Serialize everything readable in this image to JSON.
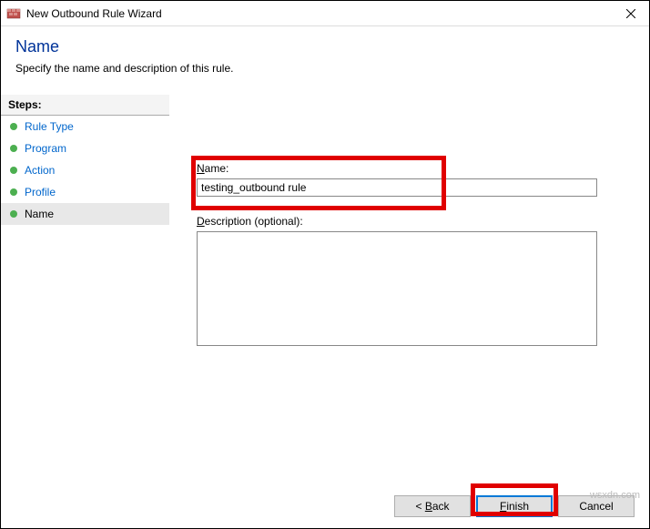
{
  "titlebar": {
    "text": "New Outbound Rule Wizard"
  },
  "header": {
    "title": "Name",
    "subtitle": "Specify the name and description of this rule."
  },
  "steps": {
    "label": "Steps:",
    "items": [
      {
        "label": "Rule Type",
        "state": "done"
      },
      {
        "label": "Program",
        "state": "done"
      },
      {
        "label": "Action",
        "state": "done"
      },
      {
        "label": "Profile",
        "state": "done"
      },
      {
        "label": "Name",
        "state": "current"
      }
    ]
  },
  "form": {
    "name_label_underline": "N",
    "name_label_rest": "ame:",
    "name_value": "testing_outbound rule",
    "desc_label_underline": "D",
    "desc_label_rest": "escription (optional):",
    "desc_value": ""
  },
  "buttons": {
    "back_prefix": "< ",
    "back_underline": "B",
    "back_rest": "ack",
    "finish_underline": "F",
    "finish_rest": "inish",
    "cancel": "Cancel"
  },
  "watermark": "wsxdn.com",
  "colors": {
    "step_done": "#4caf50",
    "step_current": "#4caf50"
  }
}
